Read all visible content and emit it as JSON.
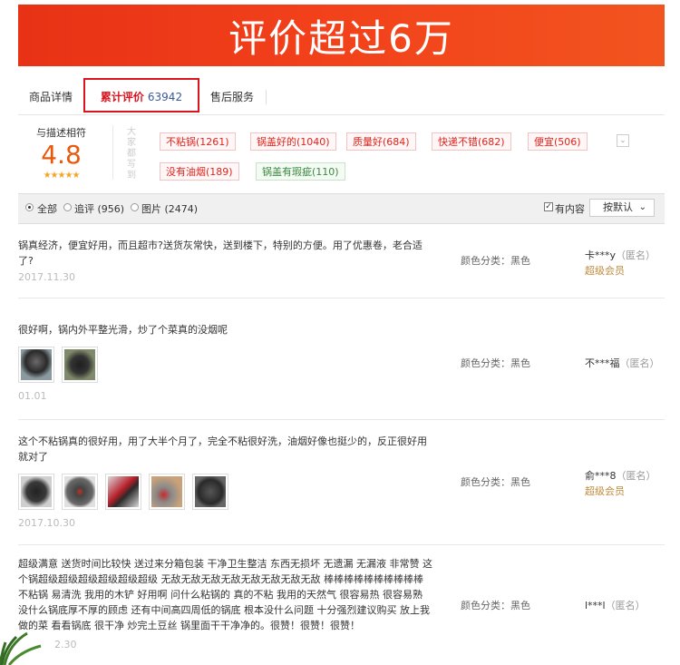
{
  "banner": {
    "title": "评价超过6万"
  },
  "tabs": {
    "details": "商品详情",
    "reviews_label": "累计评价",
    "reviews_count": "63942",
    "after_sales": "售后服务"
  },
  "rating": {
    "label": "与描述相符",
    "score": "4.8",
    "stars": "★★★★★"
  },
  "impressions": {
    "label": "大家都写到",
    "tags": [
      {
        "text": "不粘锅(1261)",
        "type": "positive"
      },
      {
        "text": "锅盖好的(1040)",
        "type": "positive"
      },
      {
        "text": "质量好(684)",
        "type": "positive"
      },
      {
        "text": "快递不错(682)",
        "type": "positive"
      },
      {
        "text": "便宜(506)",
        "type": "positive"
      },
      {
        "text": "没有油烟(189)",
        "type": "positive"
      },
      {
        "text": "锅盖有瑕疵(110)",
        "type": "negative"
      }
    ],
    "more_icon": "chevron-down-icon"
  },
  "filter": {
    "all": "全部",
    "followup": "追评 (956)",
    "pictures": "图片 (2474)",
    "has_content": "有内容",
    "sort": "按默认"
  },
  "reviews": [
    {
      "text": "锅真经济，便宜好用，而且超市?送货灰常快，送到楼下，特别的方便。用了优惠卷，老合适了?",
      "date": "2017.11.30",
      "color": "颜色分类：黑色",
      "user": "卡***y",
      "anon": "（匿名）",
      "vip": "超级会员"
    },
    {
      "text": "很好啊，锅内外平整光滑，炒了个菜真的没烟呢",
      "date": "01.01",
      "color": "颜色分类：黑色",
      "user": "不***福",
      "anon": "（匿名）",
      "vip": ""
    },
    {
      "text": "这个不粘锅真的很好用，用了大半个月了，完全不粘很好洗，油烟好像也挺少的，反正很好用就对了",
      "date": "2017.10.30",
      "color": "颜色分类：黑色",
      "user": "俞***8",
      "anon": "（匿名）",
      "vip": "超级会员"
    },
    {
      "text": "超级满意 送货时间比较快 送过来分箱包装 干净卫生整洁 东西无损坏 无遗漏 无漏液 非常赞 这个锅超级超级超级超级超级超级 无敌无敌无敌无敌无敌无敌无敌无敌 棒棒棒棒棒棒棒棒棒棒 不粘锅 易清洗 我用的木铲 好用啊 问什么粘锅的 真的不粘 我用的天然气 很容易热 很容易熟 没什么锅底厚不厚的顾虑 还有中间高四周低的锅底 根本没什么问题 十分强烈建议购买 放上我做的菜 看看锅底 很干净 炒完土豆丝 锅里面干干净净的。很赞！很赞！很赞！",
      "date": "2.30",
      "color": "颜色分类：黑色",
      "user": "l***l",
      "anon": "（匿名）",
      "vip": ""
    }
  ],
  "colors": {
    "banner_start": "#e83216",
    "banner_end": "#f2541f",
    "accent_red": "#d9141f",
    "score_orange": "#e8590c",
    "vip_gold": "#c08a3e"
  }
}
